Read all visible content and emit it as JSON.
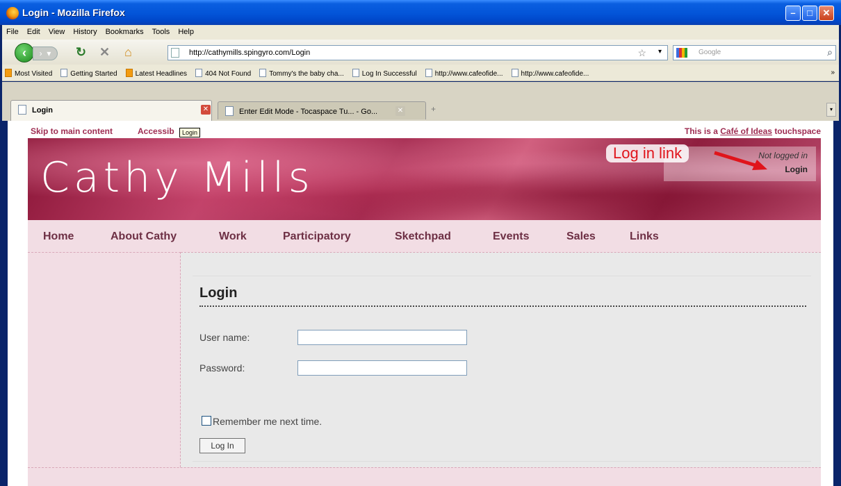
{
  "window": {
    "title": "Login - Mozilla Firefox"
  },
  "menu": [
    "File",
    "Edit",
    "View",
    "History",
    "Bookmarks",
    "Tools",
    "Help"
  ],
  "address": {
    "url": "http://cathymills.spingyro.com/Login"
  },
  "search": {
    "placeholder": "Google"
  },
  "bookmarks": [
    {
      "label": "Most Visited",
      "icon": "rss-icon"
    },
    {
      "label": "Getting Started",
      "icon": "page-icon"
    },
    {
      "label": "Latest Headlines",
      "icon": "rss-icon"
    },
    {
      "label": "404 Not Found",
      "icon": "page-icon"
    },
    {
      "label": "Tommy's the baby cha...",
      "icon": "page-icon"
    },
    {
      "label": "Log In Successful",
      "icon": "page-icon"
    },
    {
      "label": "http://www.cafeofide...",
      "icon": "page-icon"
    },
    {
      "label": "http://www.cafeofide...",
      "icon": "page-icon"
    }
  ],
  "tabs": [
    {
      "label": "Login",
      "active": true
    },
    {
      "label": "Enter Edit Mode - Tocaspace Tu... - Go...",
      "active": false
    }
  ],
  "page": {
    "skip_link": "Skip to main content",
    "accessibility_link": "Accessib",
    "tooltip": "Login",
    "cafe_prefix": "This is a",
    "cafe_link": "Café of Ideas",
    "cafe_suffix": "touchspace",
    "site_title": "Cathy Mills",
    "annotation": "Log in link",
    "not_logged_in": "Not logged in",
    "login_link": "Login",
    "nav": [
      "Home",
      "About Cathy",
      "Work",
      "Participatory",
      "Sketchpad",
      "Events",
      "Sales",
      "Links"
    ],
    "form": {
      "heading": "Login",
      "username_label": "User name:",
      "username_value": "",
      "password_label": "Password:",
      "password_value": "",
      "remember_label": "Remember me next time.",
      "remember_checked": false,
      "submit_label": "Log In"
    }
  },
  "colors": {
    "accent": "#9e2d52",
    "nav_bg": "#f2dde4",
    "annotation": "#e0141b"
  }
}
